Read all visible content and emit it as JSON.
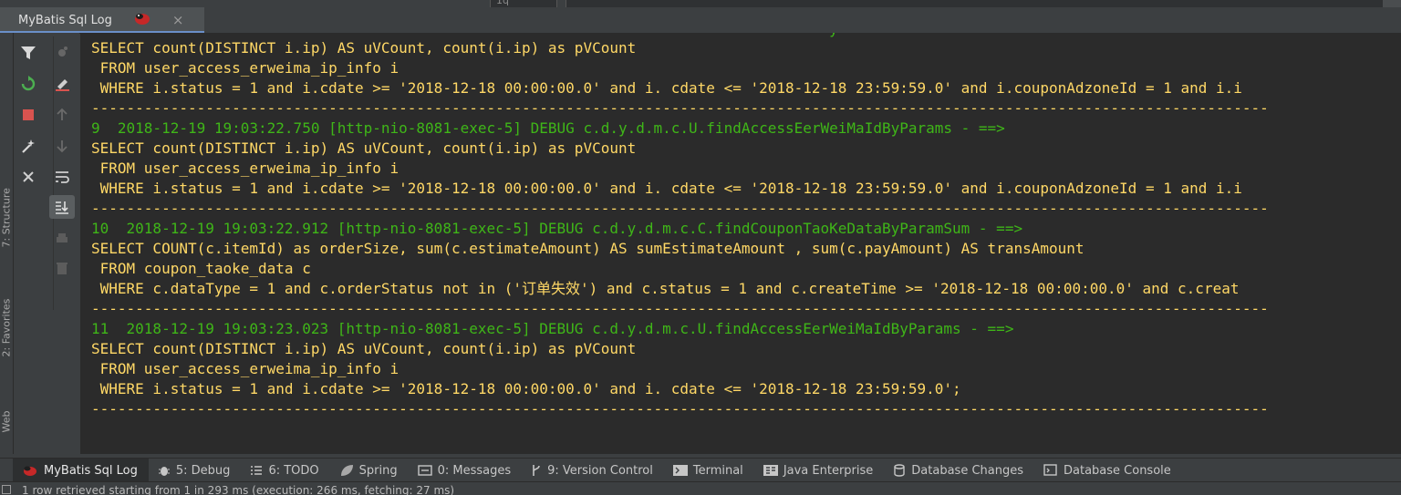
{
  "tab": {
    "title": "MyBatis Sql Log",
    "close": "×"
  },
  "top_gutter": "1q",
  "left_stripe": {
    "structure": "7: Structure",
    "favorites": "2: Favorites",
    "web": "Web"
  },
  "console": {
    "top_partial": "                                                                                    y",
    "lines": [
      {
        "kind": "sql",
        "text": "SELECT count(DISTINCT i.ip) AS uVCount, count(i.ip) as pVCount"
      },
      {
        "kind": "sql",
        "text": " FROM user_access_erweima_ip_info i"
      },
      {
        "kind": "sql",
        "text": " WHERE i.status = 1 and i.cdate >= '2018-12-18 00:00:00.0' and i. cdate <= '2018-12-18 23:59:59.0' and i.couponAdzoneId = 1 and i.i"
      },
      {
        "kind": "sep",
        "text": "--------------------------------------------------------------------------------------------------------------------------------------"
      },
      {
        "kind": "hdr",
        "text": "9  2018-12-19 19:03:22.750 [http-nio-8081-exec-5] DEBUG c.d.y.d.m.c.U.findAccessEerWeiMaIdByParams - ==>"
      },
      {
        "kind": "sql",
        "text": "SELECT count(DISTINCT i.ip) AS uVCount, count(i.ip) as pVCount"
      },
      {
        "kind": "sql",
        "text": " FROM user_access_erweima_ip_info i"
      },
      {
        "kind": "sql",
        "text": " WHERE i.status = 1 and i.cdate >= '2018-12-18 00:00:00.0' and i. cdate <= '2018-12-18 23:59:59.0' and i.couponAdzoneId = 1 and i.i"
      },
      {
        "kind": "sep",
        "text": "--------------------------------------------------------------------------------------------------------------------------------------"
      },
      {
        "kind": "hdr",
        "text": "10  2018-12-19 19:03:22.912 [http-nio-8081-exec-5] DEBUG c.d.y.d.m.c.C.findCouponTaoKeDataByParamSum - ==>"
      },
      {
        "kind": "sql",
        "text": "SELECT COUNT(c.itemId) as orderSize, sum(c.estimateAmount) AS sumEstimateAmount , sum(c.payAmount) AS transAmount"
      },
      {
        "kind": "sql",
        "text": " FROM coupon_taoke_data c"
      },
      {
        "kind": "sql",
        "text": " WHERE c.dataType = 1 and c.orderStatus not in ('订单失效') and c.status = 1 and c.createTime >= '2018-12-18 00:00:00.0' and c.creat"
      },
      {
        "kind": "sep",
        "text": "--------------------------------------------------------------------------------------------------------------------------------------"
      },
      {
        "kind": "hdr",
        "text": "11  2018-12-19 19:03:23.023 [http-nio-8081-exec-5] DEBUG c.d.y.d.m.c.U.findAccessEerWeiMaIdByParams - ==>"
      },
      {
        "kind": "sql",
        "text": "SELECT count(DISTINCT i.ip) AS uVCount, count(i.ip) as pVCount"
      },
      {
        "kind": "sql",
        "text": " FROM user_access_erweima_ip_info i"
      },
      {
        "kind": "sql",
        "text": " WHERE i.status = 1 and i.cdate >= '2018-12-18 00:00:00.0' and i. cdate <= '2018-12-18 23:59:59.0';"
      },
      {
        "kind": "sep",
        "text": "--------------------------------------------------------------------------------------------------------------------------------------"
      }
    ]
  },
  "bottom_tabs": [
    {
      "name": "mybatis-log-tab",
      "label": "MyBatis Sql Log",
      "icon": "mybatis-bug-icon",
      "active": true
    },
    {
      "name": "debug-tab",
      "label": "5: Debug",
      "icon": "bug-icon",
      "active": false
    },
    {
      "name": "todo-tab",
      "label": "6: TODO",
      "icon": "list-icon",
      "active": false
    },
    {
      "name": "spring-tab",
      "label": "Spring",
      "icon": "spring-leaf-icon",
      "active": false
    },
    {
      "name": "messages-tab",
      "label": "0: Messages",
      "icon": "messages-icon",
      "active": false
    },
    {
      "name": "version-control-tab",
      "label": "9: Version Control",
      "icon": "branch-icon",
      "active": false
    },
    {
      "name": "terminal-tab",
      "label": "Terminal",
      "icon": "terminal-icon",
      "active": false
    },
    {
      "name": "java-enterprise-tab",
      "label": "Java Enterprise",
      "icon": "java-ee-icon",
      "active": false
    },
    {
      "name": "database-changes-tab",
      "label": "Database Changes",
      "icon": "database-changes-icon",
      "active": false
    },
    {
      "name": "database-console-tab",
      "label": "Database Console",
      "icon": "database-console-icon",
      "active": false
    }
  ],
  "status": "1 row retrieved starting from 1 in 293 ms (execution: 266 ms, fetching: 27 ms)",
  "colors": {
    "sql": "#ffd866",
    "header": "#3fb618",
    "background": "#2b2b2b",
    "accent": "#6a8fc8"
  }
}
